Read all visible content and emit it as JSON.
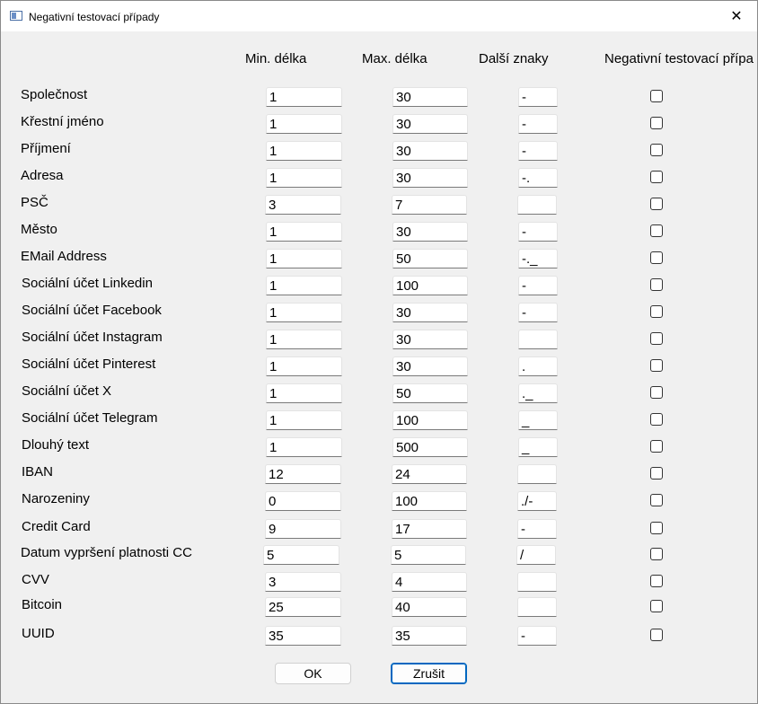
{
  "window": {
    "title": "Negativní testovací případy",
    "close_glyph": "✕",
    "icon": "app-window-icon"
  },
  "headers": {
    "min": "Min. délka",
    "max": "Max. délka",
    "extra": "Další znaky",
    "negative": "Negativní testovací přípa"
  },
  "rows": [
    {
      "label": "Společnost",
      "min": "1",
      "max": "30",
      "extra": "-",
      "checked": false
    },
    {
      "label": "Křestní jméno",
      "min": "1",
      "max": "30",
      "extra": "-",
      "checked": false
    },
    {
      "label": "Příjmení",
      "min": "1",
      "max": "30",
      "extra": "-",
      "checked": false
    },
    {
      "label": "Adresa",
      "min": "1",
      "max": "30",
      "extra": "-.",
      "checked": false
    },
    {
      "label": "PSČ",
      "min": "3",
      "max": "7",
      "extra": "",
      "checked": false
    },
    {
      "label": "Město",
      "min": "1",
      "max": "30",
      "extra": "-",
      "checked": false
    },
    {
      "label": "EMail Address",
      "min": "1",
      "max": "50",
      "extra": "-._",
      "checked": false
    },
    {
      "label": "Sociální účet Linkedin",
      "min": "1",
      "max": "100",
      "extra": "-",
      "checked": false
    },
    {
      "label": "Sociální účet Facebook",
      "min": "1",
      "max": "30",
      "extra": "-",
      "checked": false
    },
    {
      "label": "Sociální účet Instagram",
      "min": "1",
      "max": "30",
      "extra": "",
      "checked": false
    },
    {
      "label": "Sociální účet Pinterest",
      "min": "1",
      "max": "30",
      "extra": ".",
      "checked": false
    },
    {
      "label": "Sociální účet X",
      "min": "1",
      "max": "50",
      "extra": "._",
      "checked": false
    },
    {
      "label": "Sociální účet Telegram",
      "min": "1",
      "max": "100",
      "extra": "_",
      "checked": false
    },
    {
      "label": "Dlouhý text",
      "min": "1",
      "max": "500",
      "extra": "_",
      "checked": false
    },
    {
      "label": "IBAN",
      "min": "12",
      "max": "24",
      "extra": "",
      "checked": false
    },
    {
      "label": "Narozeniny",
      "min": "0",
      "max": "100",
      "extra": "./-",
      "checked": false
    },
    {
      "label": "Credit Card",
      "min": "9",
      "max": "17",
      "extra": " -",
      "checked": false
    },
    {
      "label": "Datum vypršení platnosti CC",
      "min": "5",
      "max": "5",
      "extra": "/",
      "checked": false
    },
    {
      "label": "CVV",
      "min": "3",
      "max": "4",
      "extra": "",
      "checked": false
    },
    {
      "label": "Bitcoin",
      "min": "25",
      "max": "40",
      "extra": "",
      "checked": false
    },
    {
      "label": "UUID",
      "min": "35",
      "max": "35",
      "extra": "-",
      "checked": false
    }
  ],
  "buttons": {
    "ok": "OK",
    "cancel": "Zrušit"
  }
}
